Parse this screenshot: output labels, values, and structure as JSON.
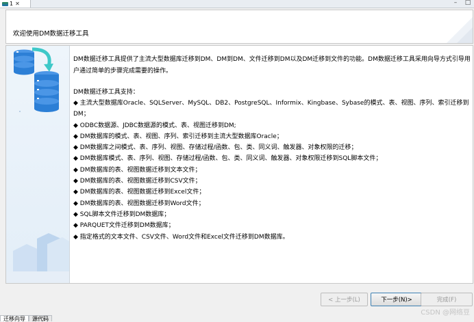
{
  "tab": {
    "label": "1"
  },
  "header": {
    "title": "欢迎使用DM数据迁移工具"
  },
  "main": {
    "intro": "DM数据迁移工具提供了主流大型数据库迁移到DM、DM到DM、文件迁移到DM以及DM迁移到文件的功能。DM数据迁移工具采用向导方式引导用户通过简单的步骤完成需要的操作。",
    "support_title": "DM数据迁移工具支持：",
    "items": [
      "◆ 主流大型数据库Oracle、SQLServer、MySQL、DB2、PostgreSQL、Informix、Kingbase、Sybase的模式、表、视图、序列、索引迁移到DM；",
      "◆ ODBC数据源、JDBC数据源的模式、表、视图迁移到DM;",
      "◆ DM数据库的模式、表、视图、序列、索引迁移到主流大型数据库Oracle；",
      "◆ DM数据库之间模式、表、序列、视图、存储过程/函数、包、类、同义词、触发器、对象权限的迁移；",
      "◆ DM数据库模式、表、序列、视图、存储过程/函数、包、类、同义词、触发器、对象权限迁移到SQL脚本文件；",
      "◆ DM数据库的表、视图数据迁移到文本文件；",
      "◆ DM数据库的表、视图数据迁移到CSV文件；",
      "◆ DM数据库的表、视图数据迁移到Excel文件；",
      "◆ DM数据库的表、视图数据迁移到Word文件；",
      "◆ SQL脚本文件迁移到DM数据库；",
      "◆ PARQUET文件迁移到DM数据库；",
      "◆ 指定格式的文本文件、CSV文件、Word文件和Excel文件迁移到DM数据库。"
    ]
  },
  "buttons": {
    "back": "< 上一步(L)",
    "next": "下一步(N)>",
    "finish": "完成(F)"
  },
  "bottom_tabs": [
    "迁移向导",
    "源代码"
  ],
  "watermark": "CSDN @网络豆",
  "colors": {
    "accent": "#2c7fd6",
    "teal": "#3ec8c8",
    "panel_bg": "#e6f0f9"
  }
}
